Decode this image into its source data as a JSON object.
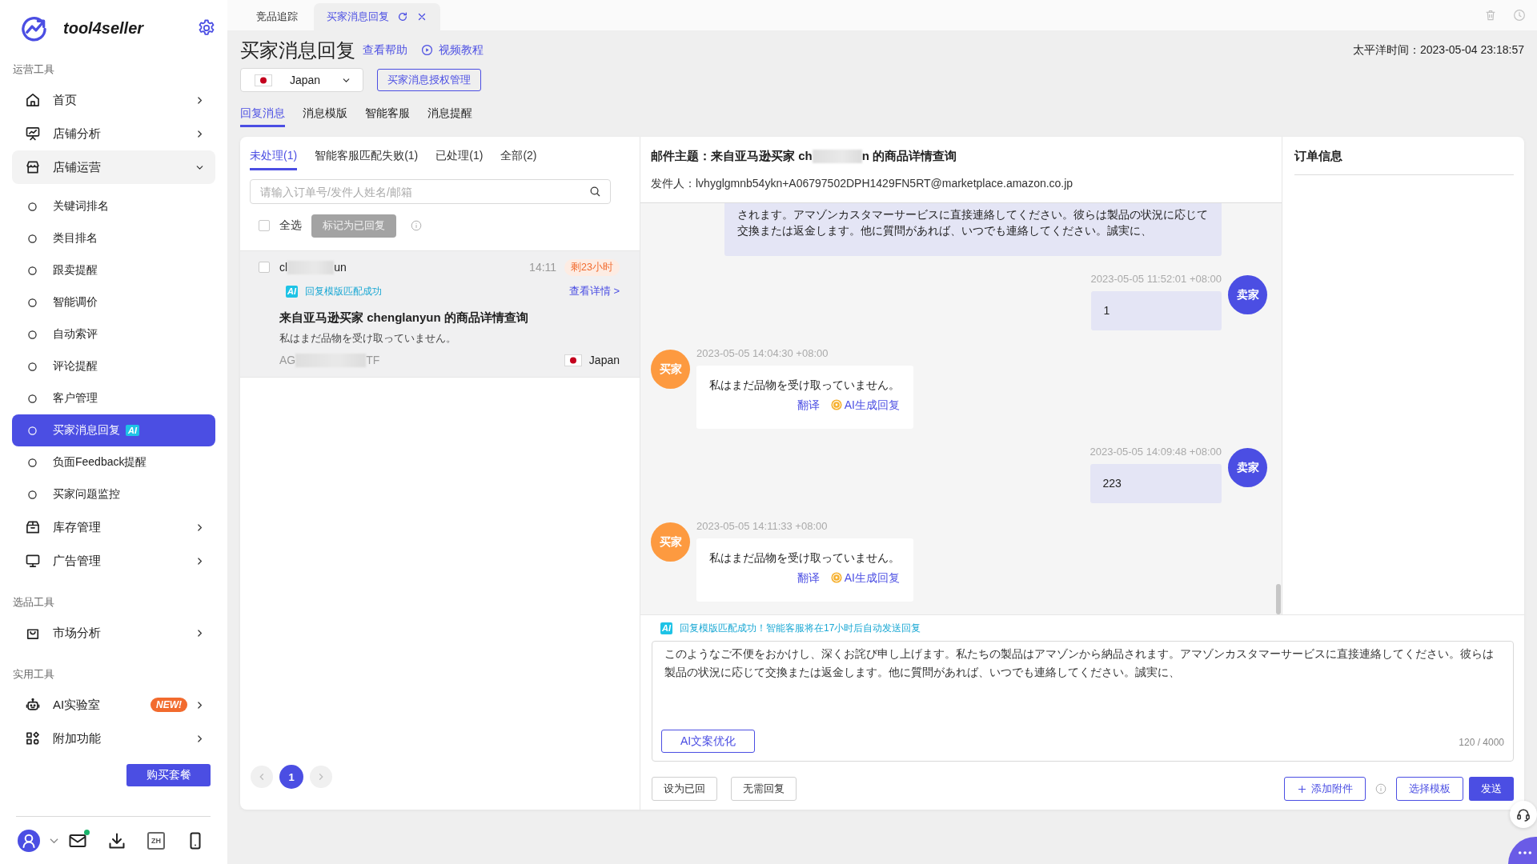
{
  "browser_tabs": [
    {
      "label": "竞品追踪",
      "selected": false
    },
    {
      "label": "买家消息回复",
      "selected": true
    }
  ],
  "sidebar": {
    "brand": "tool4seller",
    "sections": [
      {
        "title": "运营工具",
        "items": [
          {
            "label": "首页",
            "expanded": false
          },
          {
            "label": "店铺分析",
            "expanded": false
          },
          {
            "label": "店铺运营",
            "expanded": true,
            "children": [
              {
                "label": "关键词排名",
                "selected": false
              },
              {
                "label": "类目排名",
                "selected": false
              },
              {
                "label": "跟卖提醒",
                "selected": false
              },
              {
                "label": "智能调价",
                "selected": false
              },
              {
                "label": "自动索评",
                "selected": false
              },
              {
                "label": "评论提醒",
                "selected": false
              },
              {
                "label": "客户管理",
                "selected": false
              },
              {
                "label": "买家消息回复",
                "selected": true,
                "badge": {
                  "text": "AI",
                  "kind": "ai"
                }
              },
              {
                "label": "负面Feedback提醒",
                "selected": false
              },
              {
                "label": "买家问题监控",
                "selected": false
              }
            ]
          },
          {
            "label": "库存管理",
            "expanded": false
          },
          {
            "label": "广告管理",
            "expanded": false
          }
        ]
      },
      {
        "title": "选品工具",
        "items": [
          {
            "label": "市场分析",
            "expanded": false
          }
        ]
      },
      {
        "title": "实用工具",
        "items": [
          {
            "label": "AI实验室",
            "expanded": false,
            "badge": {
              "text": "NEW!",
              "kind": "new"
            }
          },
          {
            "label": "附加功能",
            "expanded": false
          }
        ]
      }
    ],
    "buy_button": "购买套餐",
    "mail_unread": true,
    "language": "ZH"
  },
  "page": {
    "title": "买家消息回复",
    "help_link": "查看帮助",
    "video_link": "视频教程",
    "pacific_time": "太平洋时间：2023-05-04 23:18:57",
    "country_select": {
      "value": "Japan"
    },
    "auth_button": "买家消息授权管理",
    "tabs": [
      {
        "label": "回复消息",
        "selected": true
      },
      {
        "label": "消息模版",
        "selected": false
      },
      {
        "label": "智能客服",
        "selected": false
      },
      {
        "label": "消息提醒",
        "selected": false
      }
    ]
  },
  "inbox": {
    "tabs": [
      {
        "label": "未处理(1)",
        "selected": true
      },
      {
        "label": "智能客服匹配失败(1)",
        "selected": false
      },
      {
        "label": "已处理(1)",
        "selected": false
      },
      {
        "label": "全部(2)",
        "selected": false
      }
    ],
    "search": {
      "placeholder": "请输入订单号/发件人姓名/邮箱"
    },
    "select_all": {
      "label": "全选",
      "checked": false
    },
    "mark_button": {
      "label": "标记为已回复",
      "disabled": true
    },
    "messages": [
      {
        "checked": false,
        "selected": true,
        "sender_start": "cl",
        "sender_end": "un",
        "time": "14:11",
        "deadline": "剩23小时",
        "ai_badge": "AI",
        "match_status": "回复模版匹配成功",
        "details_link": "查看详情 >",
        "subject": "来自亚马逊买家 chenglanyun 的商品详情查询",
        "preview": "私はまだ品物を受け取っていません。",
        "order_start": "AG",
        "order_end": "TF",
        "country": "Japan"
      }
    ],
    "pagination": {
      "prev": {
        "disabled": true
      },
      "pages": [
        {
          "label": "1",
          "selected": true
        }
      ],
      "next": {
        "disabled": true
      }
    }
  },
  "conversation": {
    "subject_start": "邮件主题：来自亚马逊买家 ch",
    "subject_end": "n 的商品详情查询",
    "sender": "发件人：lvhyglgmnb54ykn+A06797502DPH1429FN5RT@marketplace.amazon.co.jp",
    "messages": [
      {
        "kind": "seller",
        "text": "されます。アマゾンカスタマーサービスに直接連絡してください。彼らは製品の状況に応じて交換または返金します。他に質問があれば、いつでも連絡してください。誠実に、"
      },
      {
        "kind": "seller",
        "time": "2023-05-05 11:52:01 +08:00",
        "avatar": "卖家",
        "text": "1"
      },
      {
        "kind": "buyer",
        "time": "2023-05-05 14:04:30 +08:00",
        "avatar": "买家",
        "text": "私はまだ品物を受け取っていません。",
        "translate_link": "翻译",
        "ai_reply_link": "AI生成回复"
      },
      {
        "kind": "seller",
        "time": "2023-05-05 14:09:48 +08:00",
        "avatar": "卖家",
        "text": "223"
      },
      {
        "kind": "buyer",
        "time": "2023-05-05 14:11:33 +08:00",
        "avatar": "买家",
        "text": "私はまだ品物を受け取っていません。",
        "translate_link": "翻译",
        "ai_reply_link": "AI生成回复"
      }
    ]
  },
  "order_info": {
    "title": "订单信息"
  },
  "reply": {
    "ai_badge": "AI",
    "notice": "回复模版匹配成功！智能客服将在17小时后自动发送回复",
    "value": "このようなご不便をおかけし、深くお詫び申し上げます。私たちの製品はアマゾンから納品されます。アマゾンカスタマーサービスに直接連絡してください。彼らは製品の状況に応じて交換または返金します。他に質問があれば、いつでも連絡してください。誠実に、",
    "optimize_button": "AI文案优化",
    "counter": "120 / 4000",
    "left_buttons": [
      "设为已回",
      "无需回复"
    ],
    "attach_button": "添加附件",
    "template_button": "选择模板",
    "send_button": "发送"
  }
}
